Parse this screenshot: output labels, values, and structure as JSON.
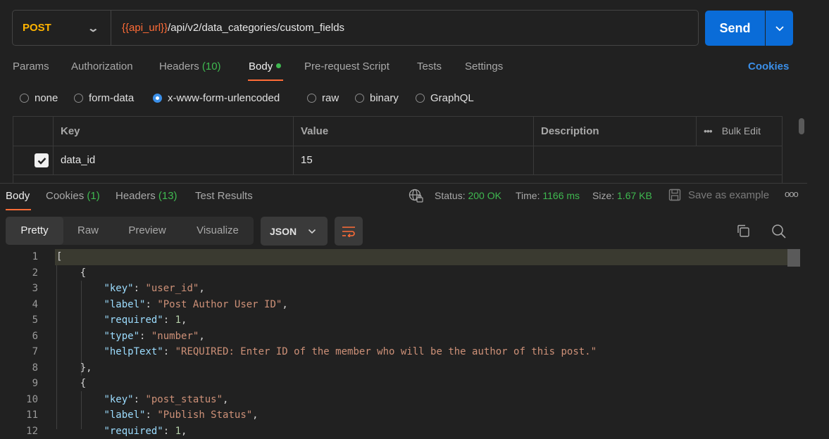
{
  "request": {
    "method": "POST",
    "url_var": "{{api_url}}",
    "url_path": "/api/v2/data_categories/custom_fields",
    "send_label": "Send"
  },
  "req_tabs": {
    "params": "Params",
    "authorization": "Authorization",
    "headers": "Headers",
    "headers_count": "(10)",
    "body": "Body",
    "prerequest": "Pre-request Script",
    "tests": "Tests",
    "settings": "Settings",
    "cookies": "Cookies"
  },
  "body_types": {
    "none": "none",
    "form_data": "form-data",
    "urlencoded": "x-www-form-urlencoded",
    "raw": "raw",
    "binary": "binary",
    "graphql": "GraphQL",
    "selected": "x-www-form-urlencoded"
  },
  "kv_table": {
    "headers": {
      "key": "Key",
      "value": "Value",
      "description": "Description",
      "bulk_edit": "Bulk Edit",
      "more": "•••"
    },
    "rows": [
      {
        "checked": true,
        "key": "data_id",
        "value": "15",
        "description": ""
      }
    ]
  },
  "response": {
    "tabs": {
      "body": "Body",
      "cookies": "Cookies",
      "cookies_count": "(1)",
      "headers": "Headers",
      "headers_count": "(13)",
      "test_results": "Test Results"
    },
    "status_label": "Status:",
    "status_value": "200 OK",
    "time_label": "Time:",
    "time_value": "1166 ms",
    "size_label": "Size:",
    "size_value": "1.67 KB",
    "save_example": "Save as example",
    "more": "ooo"
  },
  "view_tabs": {
    "pretty": "Pretty",
    "raw": "Raw",
    "preview": "Preview",
    "visualize": "Visualize"
  },
  "format": "JSON",
  "code_lines": [
    {
      "n": "1",
      "parts": [
        [
          "p",
          "["
        ]
      ]
    },
    {
      "n": "2",
      "parts": [
        [
          "p",
          "    {"
        ]
      ]
    },
    {
      "n": "3",
      "parts": [
        [
          "p",
          "        "
        ],
        [
          "k",
          "\"key\""
        ],
        [
          "p",
          ": "
        ],
        [
          "s",
          "\"user_id\""
        ],
        [
          "p",
          ","
        ]
      ]
    },
    {
      "n": "4",
      "parts": [
        [
          "p",
          "        "
        ],
        [
          "k",
          "\"label\""
        ],
        [
          "p",
          ": "
        ],
        [
          "s",
          "\"Post Author User ID\""
        ],
        [
          "p",
          ","
        ]
      ]
    },
    {
      "n": "5",
      "parts": [
        [
          "p",
          "        "
        ],
        [
          "k",
          "\"required\""
        ],
        [
          "p",
          ": "
        ],
        [
          "n",
          "1"
        ],
        [
          "p",
          ","
        ]
      ]
    },
    {
      "n": "6",
      "parts": [
        [
          "p",
          "        "
        ],
        [
          "k",
          "\"type\""
        ],
        [
          "p",
          ": "
        ],
        [
          "s",
          "\"number\""
        ],
        [
          "p",
          ","
        ]
      ]
    },
    {
      "n": "7",
      "parts": [
        [
          "p",
          "        "
        ],
        [
          "k",
          "\"helpText\""
        ],
        [
          "p",
          ": "
        ],
        [
          "s",
          "\"REQUIRED: Enter ID of the member who will be the author of this post.\""
        ]
      ]
    },
    {
      "n": "8",
      "parts": [
        [
          "p",
          "    },"
        ]
      ]
    },
    {
      "n": "9",
      "parts": [
        [
          "p",
          "    {"
        ]
      ]
    },
    {
      "n": "10",
      "parts": [
        [
          "p",
          "        "
        ],
        [
          "k",
          "\"key\""
        ],
        [
          "p",
          ": "
        ],
        [
          "s",
          "\"post_status\""
        ],
        [
          "p",
          ","
        ]
      ]
    },
    {
      "n": "11",
      "parts": [
        [
          "p",
          "        "
        ],
        [
          "k",
          "\"label\""
        ],
        [
          "p",
          ": "
        ],
        [
          "s",
          "\"Publish Status\""
        ],
        [
          "p",
          ","
        ]
      ]
    },
    {
      "n": "12",
      "parts": [
        [
          "p",
          "        "
        ],
        [
          "k",
          "\"required\""
        ],
        [
          "p",
          ": "
        ],
        [
          "n",
          "1"
        ],
        [
          "p",
          ","
        ]
      ]
    }
  ],
  "colors": {
    "accent": "#ff6c37",
    "method": "#ffb400",
    "send": "#0a6cd8",
    "success": "#3fb950",
    "link": "#3b8fe8"
  }
}
